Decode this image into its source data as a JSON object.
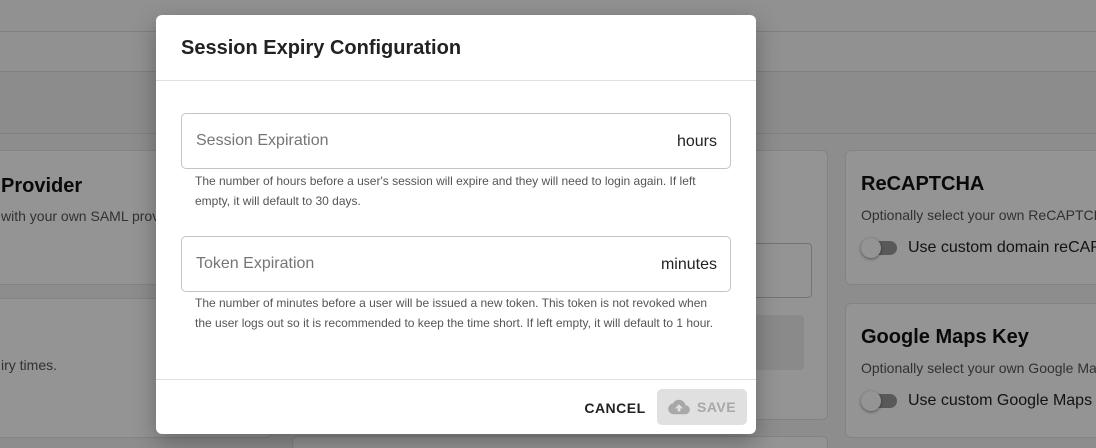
{
  "background": {
    "saml_card": {
      "title": "Provider",
      "text": "with your own SAML provid"
    },
    "expiry_card": {
      "text": "iry times."
    },
    "recaptcha_card": {
      "title": "ReCAPTCHA",
      "text": "Optionally select your own ReCAPTCH",
      "toggle_label": "Use custom domain reCAP"
    },
    "maps_card": {
      "title": "Google Maps Key",
      "text": "Optionally select your own Google Ma",
      "toggle_label": "Use custom Google Maps "
    }
  },
  "modal": {
    "title": "Session Expiry Configuration",
    "session_field": {
      "placeholder": "Session Expiration",
      "unit": "hours",
      "helper": "The number of hours before a user's session will expire and they will need to login again. If left empty, it will default to 30 days."
    },
    "token_field": {
      "placeholder": "Token Expiration",
      "unit": "minutes",
      "helper": "The number of minutes before a user will be issued a new token. This token is not revoked when the user logs out so it is recommended to keep the time short. If left empty, it will default to 1 hour."
    },
    "cancel_label": "CANCEL",
    "save_label": "SAVE",
    "save_icon": "cloud-upload-icon"
  }
}
